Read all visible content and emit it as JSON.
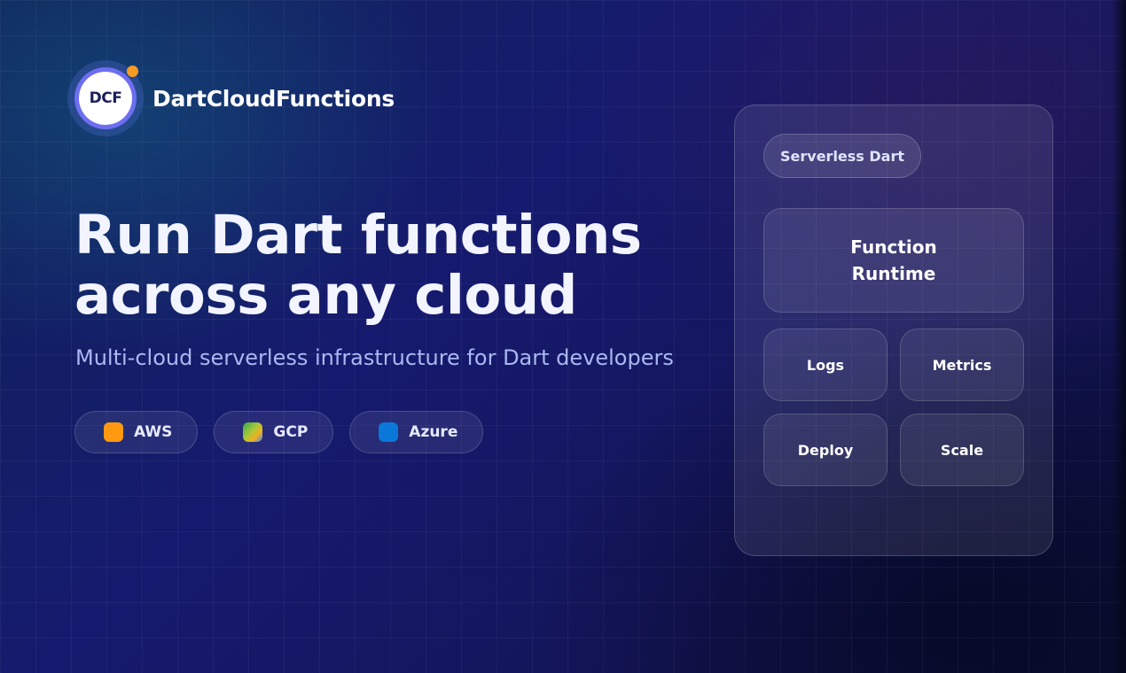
{
  "brand": {
    "logo_text": "DCF",
    "name": "DartCloudFunctions",
    "colors": {
      "ring": "#6d6ef0",
      "dot": "#f59a23"
    }
  },
  "hero": {
    "title": "Run Dart functions across any cloud",
    "subtitle": "Multi-cloud serverless infrastructure for Dart developers"
  },
  "clouds": [
    {
      "label": "AWS",
      "icon": "aws-icon",
      "color": "#ff9a10"
    },
    {
      "label": "GCP",
      "icon": "gcp-icon",
      "color": "#34a853"
    },
    {
      "label": "Azure",
      "icon": "azure-icon",
      "color": "#0a78d8"
    }
  ],
  "panel": {
    "tag": "Serverless Dart",
    "runtime": "Function Runtime",
    "tiles": [
      "Logs",
      "Metrics",
      "Deploy",
      "Scale"
    ]
  }
}
